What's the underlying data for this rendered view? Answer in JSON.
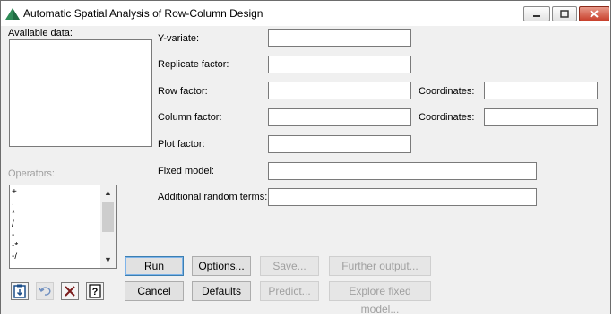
{
  "window": {
    "title": "Automatic Spatial Analysis of Row-Column Design",
    "controls": {
      "minimize": "minimize",
      "maximize": "maximize",
      "close": "close"
    }
  },
  "left_panel": {
    "available_label": "Available data:",
    "available_items": [],
    "operators_label": "Operators:",
    "operators": [
      "+",
      ".",
      "*",
      "/",
      "-",
      "-*",
      "-/"
    ]
  },
  "form": {
    "y_variate": {
      "label": "Y-variate:",
      "value": ""
    },
    "replicate_factor": {
      "label": "Replicate factor:",
      "value": ""
    },
    "row_factor": {
      "label": "Row factor:",
      "value": ""
    },
    "row_coordinates": {
      "label": "Coordinates:",
      "value": ""
    },
    "column_factor": {
      "label": "Column factor:",
      "value": ""
    },
    "column_coordinates": {
      "label": "Coordinates:",
      "value": ""
    },
    "plot_factor": {
      "label": "Plot factor:",
      "value": ""
    },
    "fixed_model": {
      "label": "Fixed model:",
      "value": ""
    },
    "additional_random_terms": {
      "label": "Additional random terms:",
      "value": ""
    }
  },
  "buttons": {
    "run": "Run",
    "options": "Options...",
    "save": "Save...",
    "further_output": "Further output...",
    "cancel": "Cancel",
    "defaults": "Defaults",
    "predict": "Predict...",
    "explore_fixed_model": "Explore fixed model..."
  },
  "icon_buttons": [
    "paste-icon",
    "undo-icon",
    "clear-icon",
    "help-icon"
  ],
  "colors": {
    "accent": "#3c7fb1",
    "disabled_text": "#a0a0a0",
    "dialog_bg": "#f0f0f0"
  }
}
